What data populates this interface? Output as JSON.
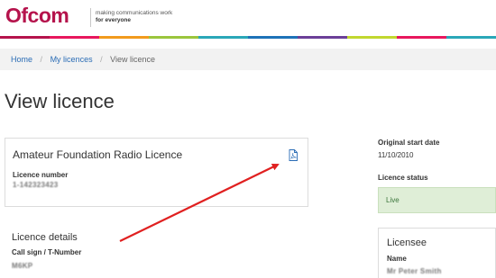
{
  "header": {
    "logo_text": "Ofcom",
    "tagline_line1": "making communications work",
    "tagline_line2": "for everyone",
    "brand_color": "#b5134c",
    "stripe_colors": [
      "#b5134c",
      "#e8175d",
      "#f29b1d",
      "#9bc53d",
      "#2aa7b8",
      "#1d72b8",
      "#6b3f98",
      "#c1d82f",
      "#e8175d",
      "#2aa7b8"
    ]
  },
  "breadcrumb": {
    "items": [
      "Home",
      "My licences"
    ],
    "separator": "/",
    "current": "View licence"
  },
  "page": {
    "title": "View licence"
  },
  "licence": {
    "title": "Amateur Foundation Radio Licence",
    "pdf_icon": "pdf-file-icon",
    "number_label": "Licence number",
    "number_value": "1-142323423"
  },
  "details": {
    "title": "Licence details",
    "callsign_label": "Call sign / T-Number",
    "callsign_value": "M6KP"
  },
  "sidebar": {
    "start_date_label": "Original start date",
    "start_date_value": "11/10/2010",
    "status_label": "Licence status",
    "status_value": "Live",
    "status_color": "#dfeed7",
    "licensee_title": "Licensee",
    "name_label": "Name",
    "name_value": "Mr Peter Smith"
  }
}
